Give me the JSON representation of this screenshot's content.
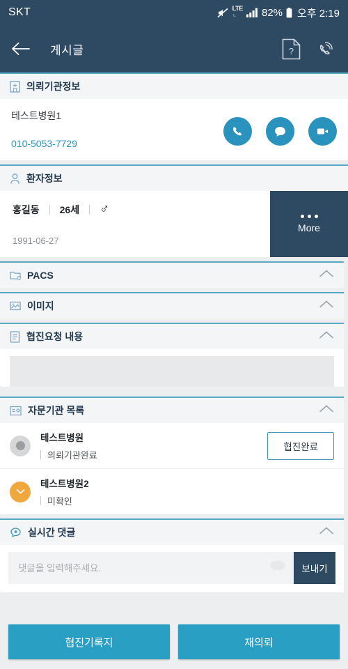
{
  "statusbar": {
    "carrier": "SKT",
    "network": "LTE",
    "battery": "82%",
    "time": "오후 2:19",
    "mute_icon": "mute-icon",
    "signal_icon": "signal-bars-icon",
    "battery_icon": "battery-icon"
  },
  "appbar": {
    "title": "게시글",
    "back_icon": "back-arrow-icon",
    "help_icon": "document-question-icon",
    "call_icon": "ringing-phone-icon"
  },
  "sections": {
    "hospital": {
      "label": "의뢰기관정보",
      "icon": "hospital-building-icon",
      "name": "테스트병원1",
      "phone": "010-5053-7729",
      "actions": [
        {
          "name": "call-button",
          "icon": "phone-icon"
        },
        {
          "name": "chat-button",
          "icon": "chat-bubble-icon"
        },
        {
          "name": "video-call-button",
          "icon": "video-camera-icon"
        }
      ]
    },
    "patient": {
      "label": "환자정보",
      "icon": "person-icon",
      "name": "홍길동",
      "age": "26세",
      "gender": "♂",
      "gender_name": "male-symbol-icon",
      "dob": "1991-06-27",
      "more_label": "More"
    },
    "pacs": {
      "label": "PACS",
      "icon": "pacs-folder-icon",
      "chevron": "chevron-up-icon"
    },
    "image": {
      "label": "이미지",
      "icon": "image-icon",
      "chevron": "chevron-up-icon"
    },
    "request": {
      "label": "협진요청 내용",
      "icon": "note-icon",
      "chevron": "chevron-up-icon"
    },
    "institutions": {
      "label": "자문기관 목록",
      "icon": "institution-list-icon",
      "chevron": "chevron-up-icon",
      "rows": [
        {
          "name": "테스트병원",
          "status": "의뢰기관완료",
          "avatar": "gray",
          "button": "협진완료"
        },
        {
          "name": "테스트병원2",
          "status": "미확인",
          "avatar": "orange",
          "button": null
        }
      ]
    },
    "comments": {
      "label": "실시간 댓글",
      "icon": "comment-bubble-icon",
      "chevron": "chevron-up-icon",
      "placeholder": "댓글을 입력해주세요.",
      "value": "",
      "send_label": "보내기",
      "watermark_icon": "chat-bubble-watermark-icon"
    }
  },
  "bottombar": {
    "record_label": "협진기록지",
    "rerequest_label": "재의뢰"
  },
  "colors": {
    "header_navy": "#2e4a63",
    "accent_teal": "#2a9fc4",
    "link_blue": "#2a93bd",
    "orange": "#f0a73c",
    "page_bg": "#eceef0"
  }
}
